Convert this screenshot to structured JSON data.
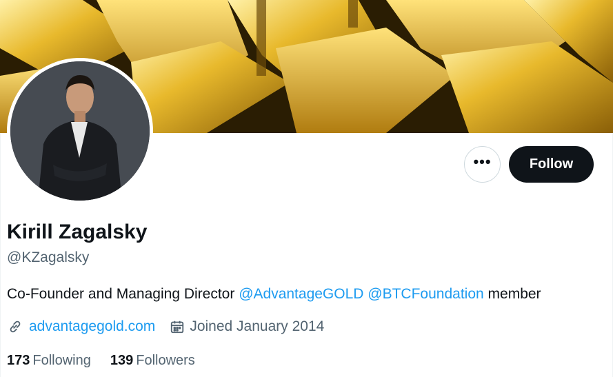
{
  "profile": {
    "display_name": "Kirill Zagalsky",
    "handle": "@KZagalsky",
    "bio": {
      "text_before": "Co-Founder and Managing Director ",
      "mention_1": "@AdvantageGOLD",
      "mention_2": "@BTCFoundation",
      "text_after": " member"
    },
    "website": "advantagegold.com",
    "joined": "Joined January 2014",
    "following_count": "173",
    "following_label": "Following",
    "followers_count": "139",
    "followers_label": "Followers"
  },
  "actions": {
    "more_label": "•••",
    "follow_label": "Follow"
  },
  "icons": {
    "more": "more-horizontal-icon",
    "link": "link-icon",
    "calendar": "calendar-icon"
  },
  "colors": {
    "accent": "#1d9bf0",
    "primary_text": "#0f1419",
    "secondary_text": "#536471",
    "follow_bg": "#0f1419"
  }
}
